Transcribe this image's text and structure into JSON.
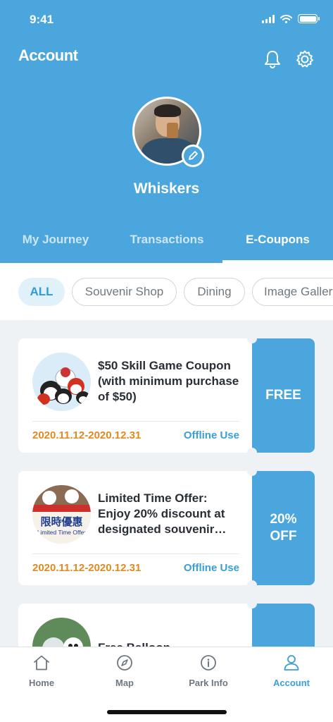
{
  "status_bar": {
    "time": "9:41"
  },
  "header": {
    "title": "Account",
    "username": "Whiskers"
  },
  "tabs": [
    {
      "label": "My Journey"
    },
    {
      "label": "Transactions"
    },
    {
      "label": "E-Coupons"
    }
  ],
  "active_tab": "E-Coupons",
  "filters": [
    {
      "label": "ALL"
    },
    {
      "label": "Souvenir Shop"
    },
    {
      "label": "Dining"
    },
    {
      "label": "Image Gallery"
    }
  ],
  "active_filter": "ALL",
  "coupons": [
    {
      "title": "$50 Skill Game Coupon (with minimum purchase of $50)",
      "date": "2020.11.12-2020.12.31",
      "usage": "Offline Use",
      "badge": "FREE"
    },
    {
      "title": "Limited Time Offer: Enjoy 20% discount at designated souvenir…",
      "date": "2020.11.12-2020.12.31",
      "usage": "Offline Use",
      "badge": "20% OFF",
      "thumb_text_1": "限時優惠",
      "thumb_text_2": "Limited Time Offer"
    },
    {
      "title": "Free Balloon",
      "date": "",
      "usage": "",
      "badge": ""
    }
  ],
  "bottom_nav": [
    {
      "label": "Home",
      "icon": "home-icon"
    },
    {
      "label": "Map",
      "icon": "compass-icon"
    },
    {
      "label": "Park Info",
      "icon": "info-icon"
    },
    {
      "label": "Account",
      "icon": "user-icon"
    }
  ],
  "colors": {
    "primary": "#4ba6dd",
    "accent_text": "#3a9fd8",
    "date": "#e08a1e",
    "background": "#eef2f5"
  }
}
